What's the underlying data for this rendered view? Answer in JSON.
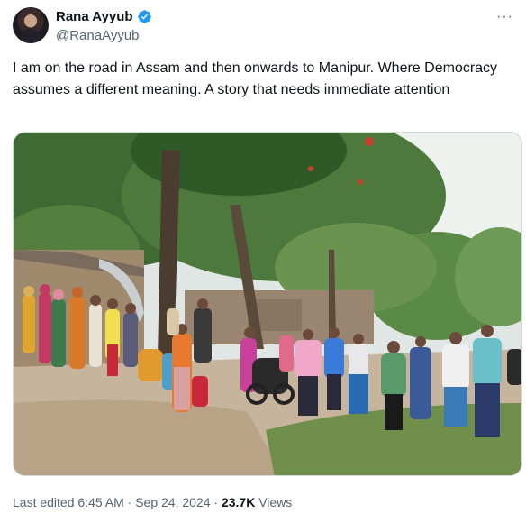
{
  "author": {
    "display_name": "Rana Ayyub",
    "handle": "@RanaAyyub",
    "verified_icon": "verified-badge-icon",
    "verified_color": "#1d9bf0"
  },
  "more_icon": "more-options-icon",
  "tweet": {
    "text": "I am on the road in Assam and then onwards to Manipur. Where Democracy assumes a different meaning. A story that needs immediate attention"
  },
  "meta": {
    "edited_label": "Last edited",
    "time": "6:45 AM",
    "separator": "·",
    "date": "Sep 24, 2024",
    "views_count": "23.7K",
    "views_label": "Views"
  }
}
